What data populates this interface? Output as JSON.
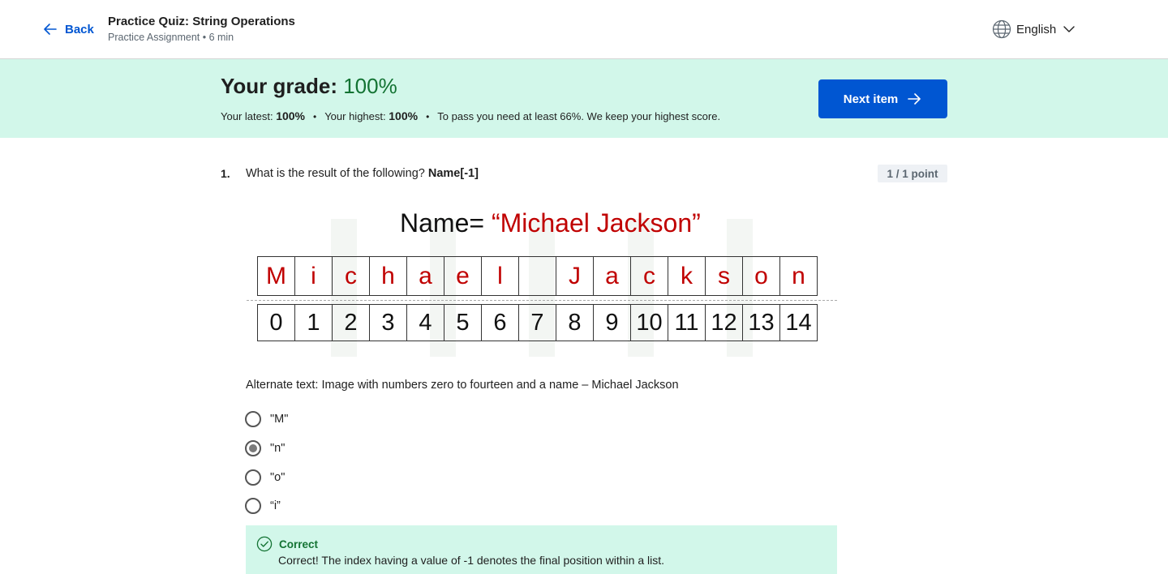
{
  "header": {
    "back_label": "Back",
    "title": "Practice Quiz: String Operations",
    "subtitle": "Practice Assignment • 6 min",
    "language": "English"
  },
  "banner": {
    "grade_label": "Your grade:",
    "grade_value": "100%",
    "latest_label": "Your latest:",
    "latest_value": "100%",
    "highest_label": "Your highest:",
    "highest_value": "100%",
    "pass_note": "To pass you need at least 66%. We keep your highest score.",
    "next_label": "Next item"
  },
  "question": {
    "number": "1.",
    "text": "What is the result of the following?",
    "code": "Name[-1]",
    "points": "1 / 1 point",
    "figure": {
      "label": "Name=",
      "value": "“Michael Jackson”",
      "characters": [
        "M",
        "i",
        "c",
        "h",
        "a",
        "e",
        "l",
        " ",
        "J",
        "a",
        "c",
        "k",
        "s",
        "o",
        "n"
      ],
      "indices": [
        "0",
        "1",
        "2",
        "3",
        "4",
        "5",
        "6",
        "7",
        "8",
        "9",
        "10",
        "11",
        "12",
        "13",
        "14"
      ]
    },
    "alt_text": "Alternate text: Image with numbers zero to fourteen and a name – Michael Jackson",
    "options": [
      {
        "label": "\"M\"",
        "selected": false
      },
      {
        "label": "\"n\"",
        "selected": true
      },
      {
        "label": "\"o\"",
        "selected": false
      },
      {
        "label": "“i”",
        "selected": false
      }
    ]
  },
  "feedback": {
    "status": "Correct",
    "message": "Correct! The index having a value of -1 denotes the final position within a list."
  },
  "colors": {
    "accent": "#0056d2",
    "banner_bg": "#d2f7ea",
    "success": "#137333",
    "figure_red": "#c00000"
  }
}
